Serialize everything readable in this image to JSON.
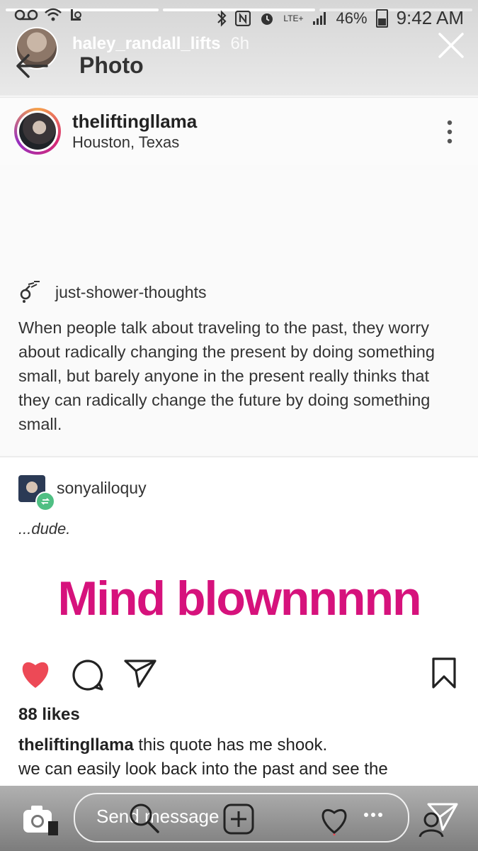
{
  "status_bar": {
    "battery": "46%",
    "time": "9:42 AM",
    "network": "LTE+"
  },
  "story": {
    "username": "haley_randall_lifts",
    "age": "6h",
    "title": "Photo"
  },
  "post": {
    "username": "theliftingllama",
    "location": "Houston, Texas"
  },
  "quote": {
    "username": "just-shower-thoughts",
    "text": "When people talk about traveling to the past, they worry about radically changing the present by doing something small, but barely anyone in the present really thinks that they can radically change the future by doing something small."
  },
  "reblog": {
    "username": "sonyaliloquy",
    "comment": "...dude.",
    "overlay_text": "Mind blownnnnn"
  },
  "engagement": {
    "likes": "88 likes",
    "liked": true
  },
  "caption": {
    "username": "theliftingllama",
    "text": "this quote has me shook.",
    "line2": "we can easily look back into the past and see the"
  },
  "reply_bar": {
    "placeholder": "Send message"
  },
  "colors": {
    "like_red": "#ed4956",
    "overlay_magenta": "#d6127c",
    "reblog_green": "#4fbf83"
  },
  "icons": [
    "back-arrow-icon",
    "close-icon",
    "more-icon",
    "reblog-icon",
    "heart-icon",
    "comment-icon",
    "share-icon",
    "bookmark-icon",
    "camera-icon",
    "search-icon",
    "add-icon",
    "direct-message-icon"
  ]
}
